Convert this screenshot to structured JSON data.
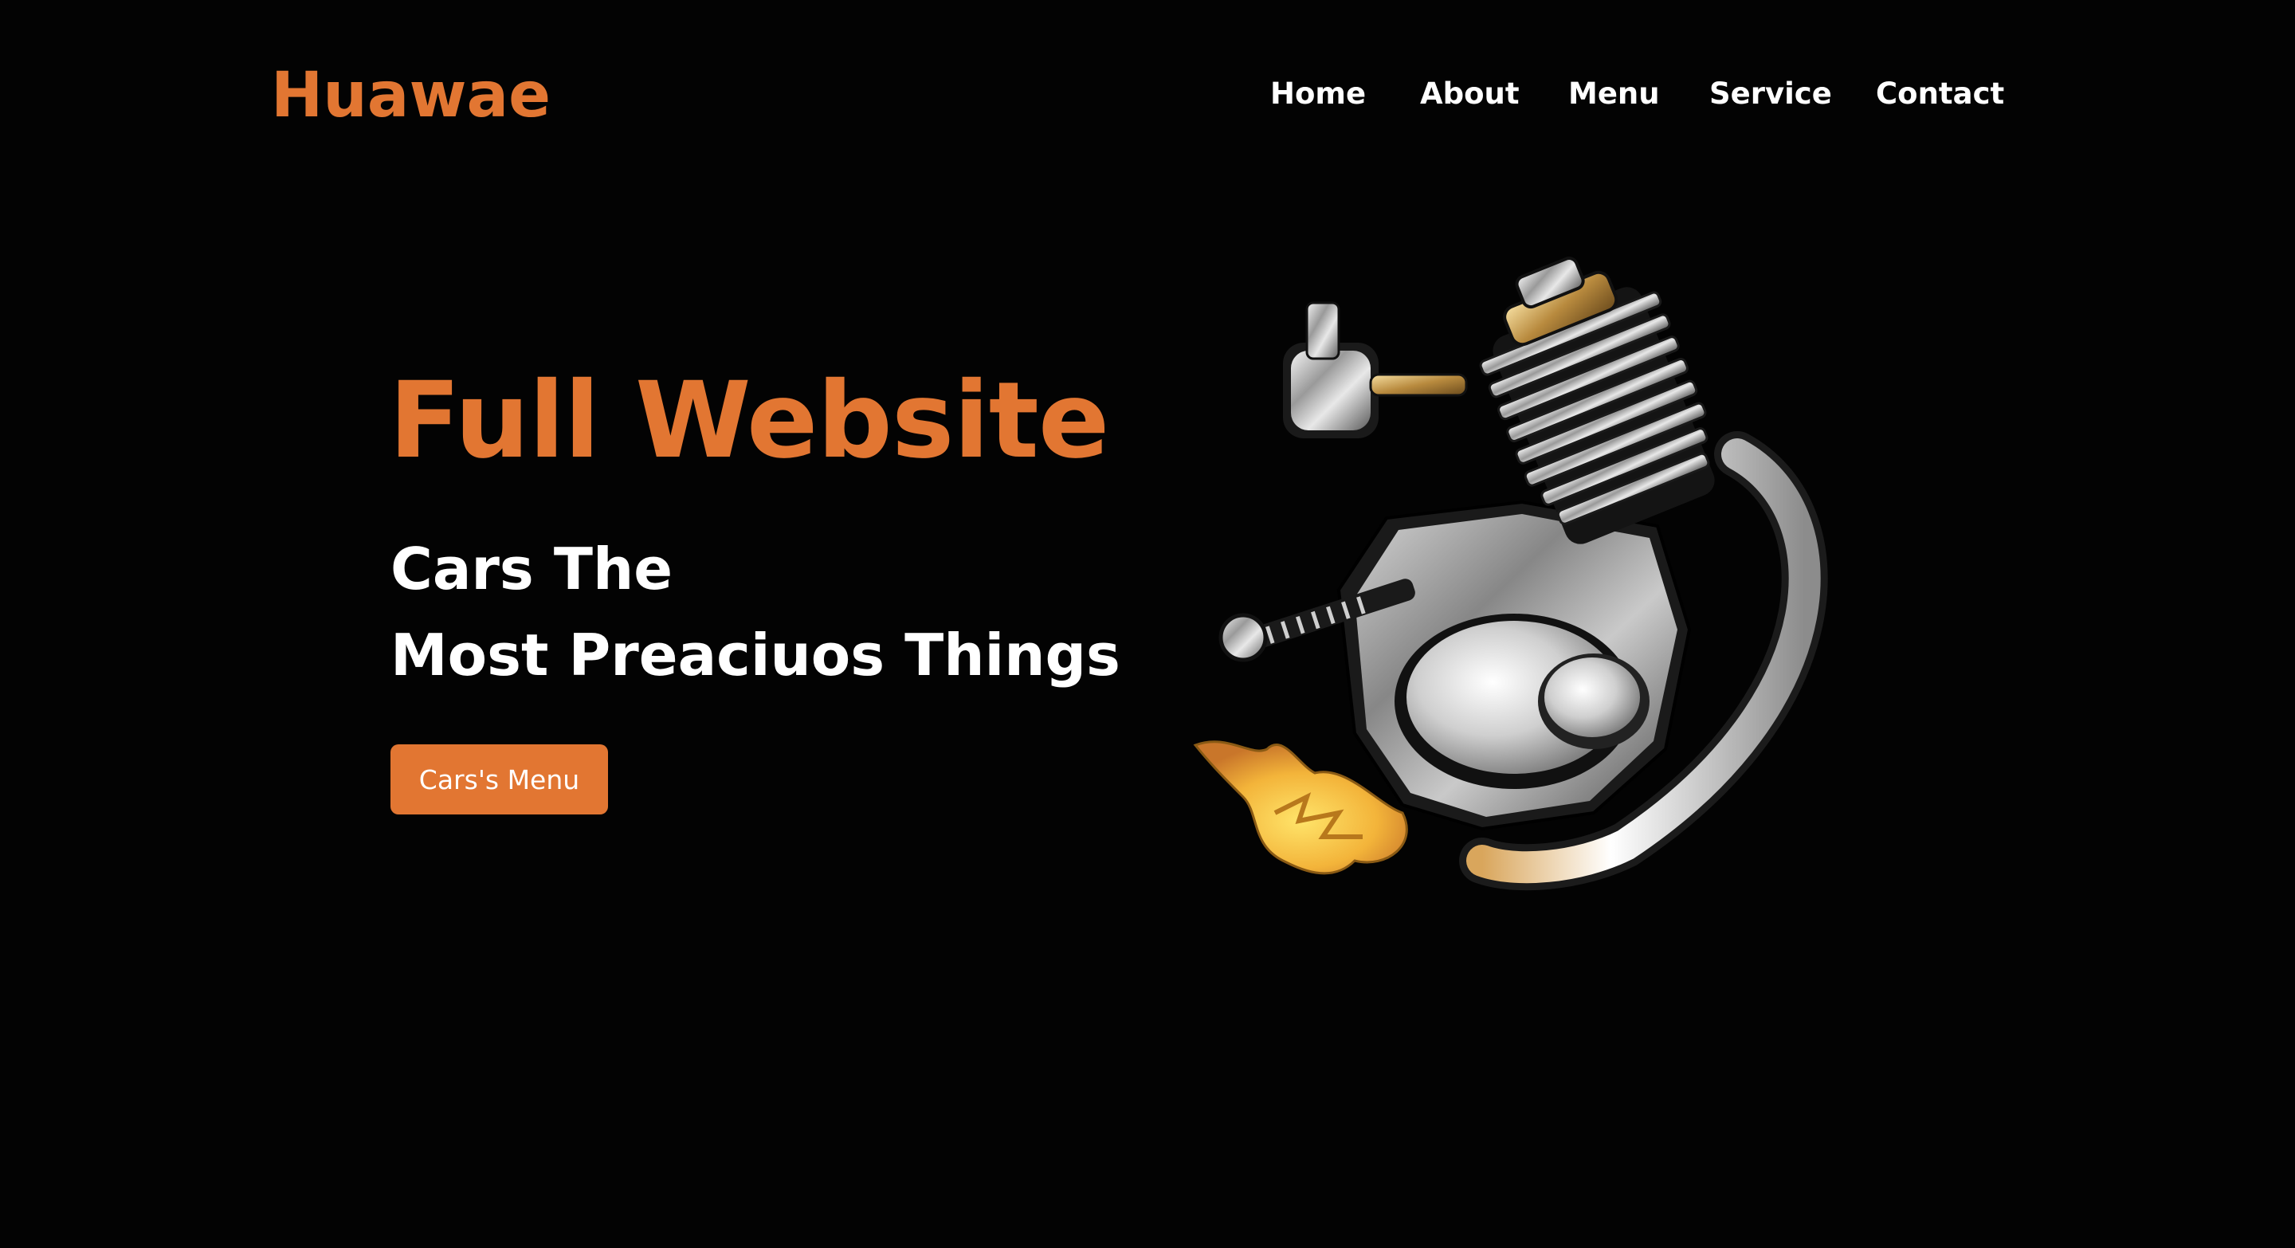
{
  "header": {
    "logo": "Huawae",
    "nav": [
      {
        "label": "Home"
      },
      {
        "label": "About"
      },
      {
        "label": "Menu"
      },
      {
        "label": "Service"
      },
      {
        "label": "Contact"
      }
    ]
  },
  "hero": {
    "title": "Full Website",
    "subtitle_line1": "Cars The",
    "subtitle_line2": "Most Preaciuos Things",
    "cta_label": "Cars's Menu",
    "illustration": "motorcycle-engine-with-flame"
  },
  "colors": {
    "background": "#030303",
    "accent": "#e27632",
    "text": "#ffffff"
  }
}
